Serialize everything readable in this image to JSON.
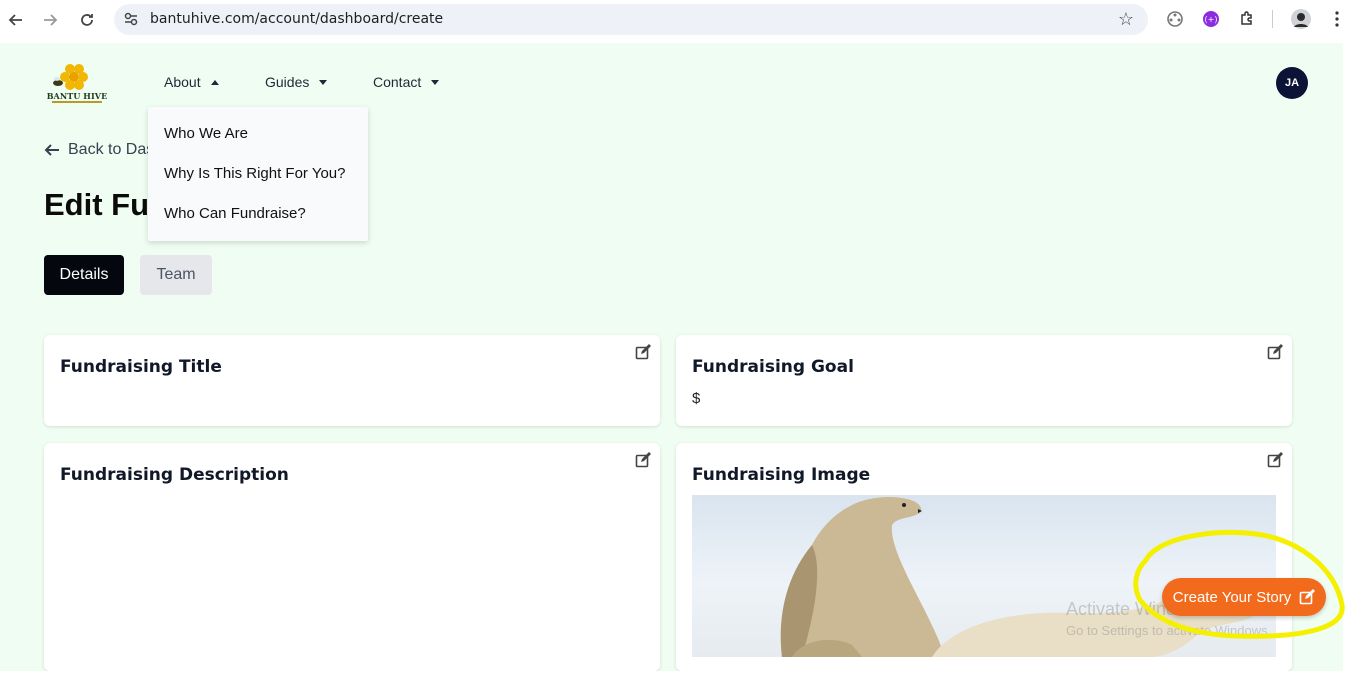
{
  "browser": {
    "url": "bantuhive.com/account/dashboard/create"
  },
  "brand": {
    "name": "BANTU HIVE",
    "colors": {
      "accent": "#f26b1d",
      "dark": "#04070d",
      "page_bg": "#effdf2",
      "avatar_bg": "#0b1437"
    }
  },
  "nav": {
    "about": "About",
    "guides": "Guides",
    "contact": "Contact"
  },
  "dropdown": {
    "items": [
      "Who We Are",
      "Why Is This Right For You?",
      "Who Can Fundraise?"
    ]
  },
  "user": {
    "initials": "JA"
  },
  "back_link": "Back to Das",
  "page_title": "Edit Fur",
  "tabs": [
    "Details",
    "Team"
  ],
  "cards": {
    "title": {
      "label": "Fundraising Title"
    },
    "goal": {
      "label": "Fundraising Goal",
      "value": "$"
    },
    "description": {
      "label": "Fundraising Description"
    },
    "image": {
      "label": "Fundraising Image"
    }
  },
  "watermark": {
    "line1": "Activate Windows",
    "line2": "Go to Settings to activate Windows."
  },
  "story_button": "Create Your Story"
}
